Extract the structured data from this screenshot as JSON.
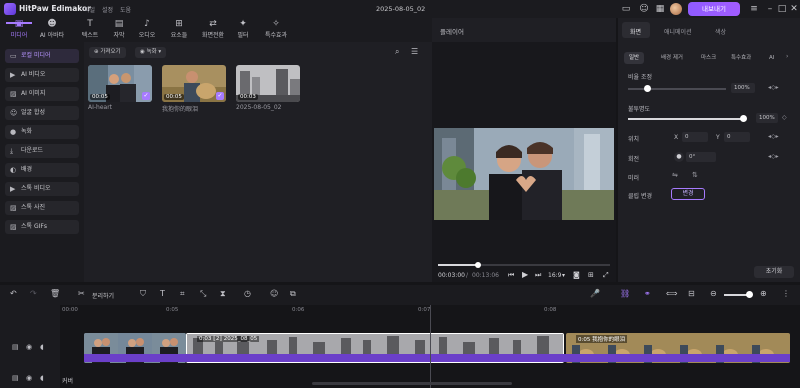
{
  "app": {
    "name": "HitPaw Edimakor",
    "menu": [
      "파일",
      "설정",
      "도움"
    ],
    "document_title": "2025-08-05_02",
    "subscribe_label": "내보내기"
  },
  "toolbar": {
    "tabs": [
      {
        "label": "미디어",
        "icon": "media-icon"
      },
      {
        "label": "AI 아바타",
        "icon": "ai-avatar-icon"
      },
      {
        "label": "텍스트",
        "icon": "text-icon"
      },
      {
        "label": "자막",
        "icon": "subtitle-icon"
      },
      {
        "label": "오디오",
        "icon": "audio-icon"
      },
      {
        "label": "요소들",
        "icon": "elements-icon"
      },
      {
        "label": "화면전환",
        "icon": "transition-icon"
      },
      {
        "label": "필터",
        "icon": "filter-icon"
      },
      {
        "label": "특수효과",
        "icon": "effects-icon"
      }
    ]
  },
  "sidebar": {
    "items": [
      {
        "label": "로컬 미디어",
        "icon": "folder-icon"
      },
      {
        "label": "AI 비디오",
        "icon": "ai-video-icon"
      },
      {
        "label": "AI 이미지",
        "icon": "ai-image-icon"
      },
      {
        "label": "얼굴 합성",
        "icon": "face-swap-icon"
      },
      {
        "label": "녹화",
        "icon": "record-icon"
      },
      {
        "label": "다운로드",
        "icon": "download-icon"
      },
      {
        "label": "배경",
        "icon": "background-icon"
      },
      {
        "label": "스톡 비디오",
        "icon": "stock-video-icon"
      },
      {
        "label": "스톡 사진",
        "icon": "stock-photo-icon"
      },
      {
        "label": "스톡 GIFs",
        "icon": "stock-gif-icon"
      }
    ]
  },
  "media": {
    "import_label": "가져오기",
    "record_label": "녹화",
    "items": [
      {
        "label": "AI-heart",
        "duration": "00:05",
        "checked": true
      },
      {
        "label": "我抱你的眼泪",
        "duration": "00:05",
        "checked": true
      },
      {
        "label": "2025-08-05_02",
        "duration": "00:03",
        "checked": false
      }
    ]
  },
  "player": {
    "title": "플레이어",
    "current_time": "00:03:00",
    "total_time": "00:13:06",
    "aspect": "16:9",
    "progress": 0.23
  },
  "properties": {
    "tabs": [
      "화면",
      "애니메이션",
      "색상"
    ],
    "subtabs": [
      "일반",
      "배경 제거",
      "마스크",
      "특수효과",
      "AI"
    ],
    "scale": {
      "label": "비율 조정",
      "value": "100%",
      "level": 0.05
    },
    "opacity": {
      "label": "불투명도",
      "value": "100%",
      "level": 1.0
    },
    "position": {
      "label": "위치",
      "x_label": "X",
      "x_value": "0",
      "y_label": "Y",
      "y_value": "0"
    },
    "rotation": {
      "label": "회전",
      "value": "0°"
    },
    "mirror": {
      "label": "미러"
    },
    "clip_change": {
      "label": "클립 변경",
      "button": "변경"
    },
    "reset_label": "초기화"
  },
  "timeline": {
    "split_label": "분리하기",
    "ruler": [
      "00:00",
      "0:05",
      "0:06",
      "0:07",
      "0:08"
    ],
    "clips": [
      {
        "label": ""
      },
      {
        "label": "0:03 ⟦2⟧ 2025_08_05"
      },
      {
        "label": "0:05 我抱你的眼泪"
      }
    ],
    "cover_label": "커버"
  }
}
